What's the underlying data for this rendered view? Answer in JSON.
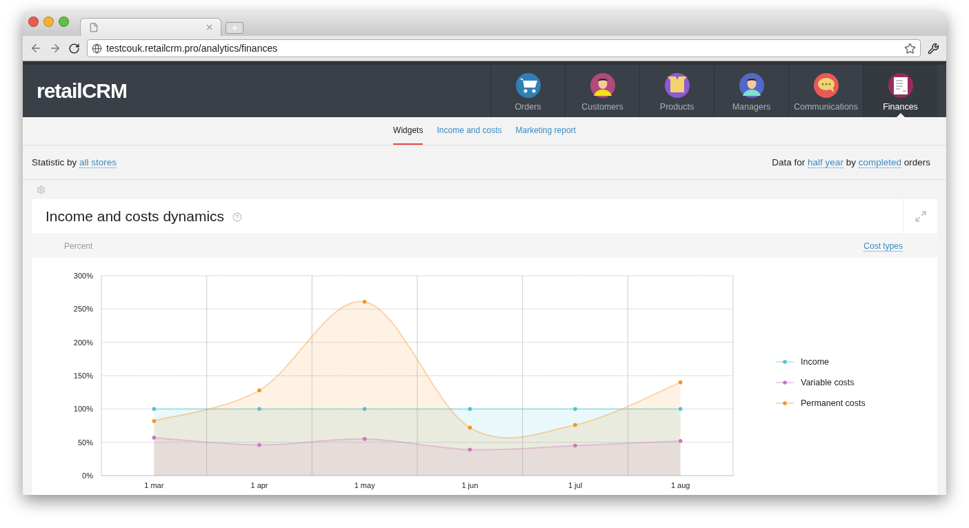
{
  "browser": {
    "address": "testcouk.retailcrm.pro/analytics/finances"
  },
  "header": {
    "logo": "retailCRM",
    "nav": [
      {
        "label": "Orders",
        "kind": "cart",
        "selected": false
      },
      {
        "label": "Customers",
        "kind": "man",
        "selected": false
      },
      {
        "label": "Products",
        "kind": "box",
        "selected": false
      },
      {
        "label": "Managers",
        "kind": "woman",
        "selected": false
      },
      {
        "label": "Communications",
        "kind": "chat",
        "selected": false
      },
      {
        "label": "Finances",
        "kind": "doc",
        "selected": true
      }
    ]
  },
  "tabs": [
    {
      "label": "Widgets",
      "selected": true
    },
    {
      "label": "Income and costs",
      "selected": false
    },
    {
      "label": "Marketing report",
      "selected": false
    }
  ],
  "filters": {
    "left": {
      "text": "Statistic by",
      "link": "all stores"
    },
    "right": {
      "text_1": "Data for",
      "link_1": "half year",
      "text_2": "by",
      "link_2": "completed",
      "text_3": "orders"
    }
  },
  "widget": {
    "title": "Income and costs dynamics",
    "unit": "Percent",
    "cost_types": "Cost types",
    "chart_data": {
      "type": "area",
      "grid": true,
      "legend": true,
      "categories": [
        "1 mar",
        "1 apr",
        "1 may",
        "1 jun",
        "1 jul",
        "1 aug"
      ],
      "ylim": [
        0,
        300
      ],
      "yticks": [
        {
          "value": 0,
          "label": "0%"
        },
        {
          "value": 50,
          "label": "50%"
        },
        {
          "value": 100,
          "label": "100%"
        },
        {
          "value": 150,
          "label": "150%"
        },
        {
          "value": 200,
          "label": "200%"
        },
        {
          "value": 250,
          "label": "250%"
        },
        {
          "value": 300,
          "label": "300%"
        }
      ],
      "series": [
        {
          "name": "Income",
          "color": "#4bc6d6",
          "values": [
            100,
            100,
            100,
            100,
            100,
            100
          ]
        },
        {
          "name": "Variable costs",
          "color": "#c874d0",
          "values": [
            57,
            46,
            55,
            39,
            45,
            52
          ]
        },
        {
          "name": "Permanent costs",
          "color": "#f7931e",
          "values": [
            82,
            128,
            261,
            72,
            76,
            140
          ]
        }
      ]
    }
  }
}
